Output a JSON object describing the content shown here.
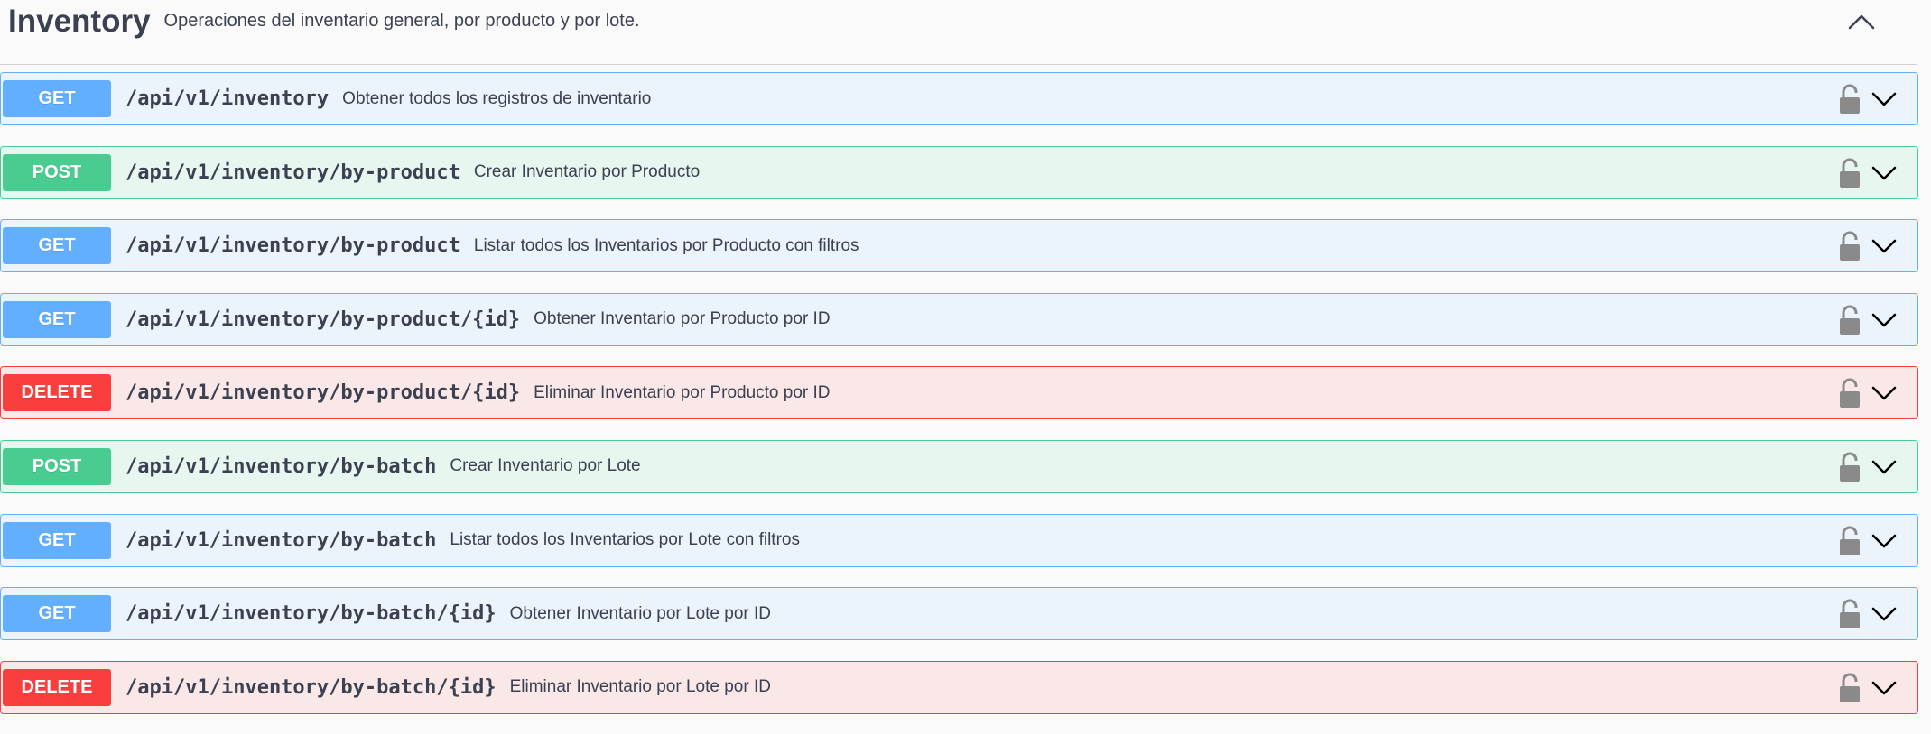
{
  "tag": {
    "title": "Inventory",
    "description": "Operaciones del inventario general, por producto y por lote."
  },
  "operations": [
    {
      "method": "GET",
      "path": "/api/v1/inventory",
      "summary": "Obtener todos los registros de inventario"
    },
    {
      "method": "POST",
      "path": "/api/v1/inventory/by-product",
      "summary": "Crear Inventario por Producto"
    },
    {
      "method": "GET",
      "path": "/api/v1/inventory/by-product",
      "summary": "Listar todos los Inventarios por Producto con filtros"
    },
    {
      "method": "GET",
      "path": "/api/v1/inventory/by-product/{id}",
      "summary": "Obtener Inventario por Producto por ID"
    },
    {
      "method": "DELETE",
      "path": "/api/v1/inventory/by-product/{id}",
      "summary": "Eliminar Inventario por Producto por ID"
    },
    {
      "method": "POST",
      "path": "/api/v1/inventory/by-batch",
      "summary": "Crear Inventario por Lote"
    },
    {
      "method": "GET",
      "path": "/api/v1/inventory/by-batch",
      "summary": "Listar todos los Inventarios por Lote con filtros"
    },
    {
      "method": "GET",
      "path": "/api/v1/inventory/by-batch/{id}",
      "summary": "Obtener Inventario por Lote por ID"
    },
    {
      "method": "DELETE",
      "path": "/api/v1/inventory/by-batch/{id}",
      "summary": "Eliminar Inventario por Lote por ID"
    }
  ],
  "colors": {
    "get": "#61affe",
    "post": "#49cc90",
    "delete": "#f93e3e",
    "text": "#3b4151",
    "icon": "#8a8a8a"
  },
  "icons": {
    "collapse": "chevron-up-icon",
    "lock": "lock-open-icon",
    "expand": "chevron-down-icon"
  }
}
